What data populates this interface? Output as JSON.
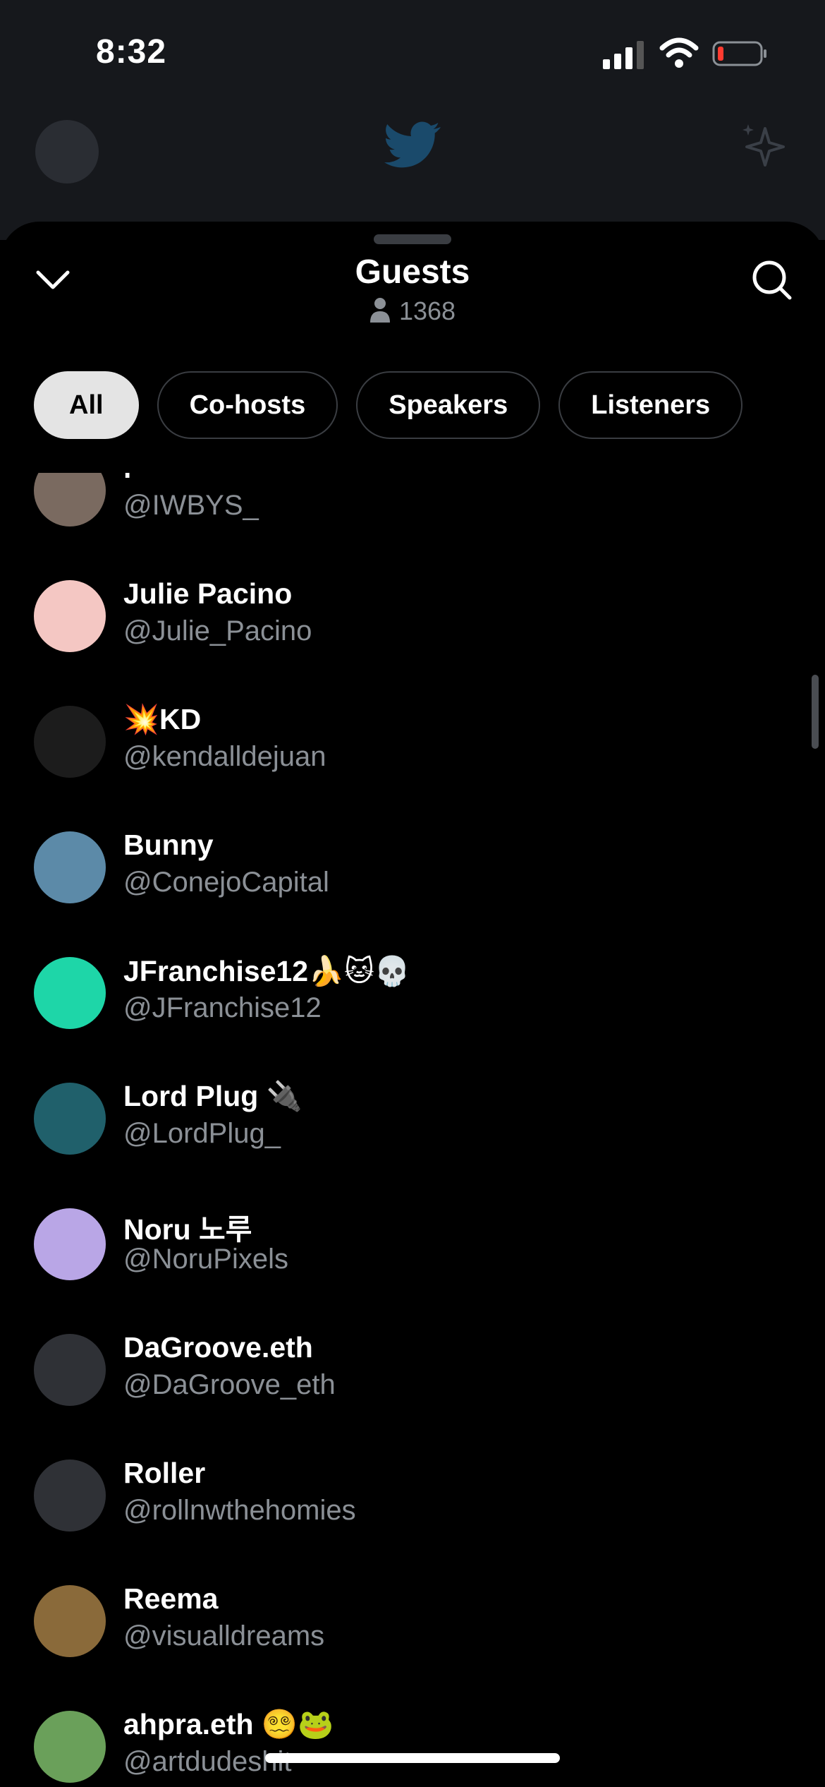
{
  "status": {
    "time": "8:32"
  },
  "sheet": {
    "title": "Guests",
    "count": "1368",
    "filters": [
      "All",
      "Co-hosts",
      "Speakers",
      "Listeners"
    ]
  },
  "guests": [
    {
      "name": "r",
      "handle": "@IWBYS_",
      "avatar_color": "#7a6a60"
    },
    {
      "name": "Julie Pacino",
      "handle": "@Julie_Pacino",
      "avatar_color": "#f4c7c3"
    },
    {
      "name": "💥KD",
      "handle": "@kendalldejuan",
      "avatar_color": "#1c1c1c"
    },
    {
      "name": "Bunny",
      "handle": "@ConejoCapital",
      "avatar_color": "#5c8aa8"
    },
    {
      "name": "JFranchise12🍌🐱💀",
      "handle": "@JFranchise12",
      "avatar_color": "#1ed6a8"
    },
    {
      "name": "Lord Plug 🔌",
      "handle": "@LordPlug_",
      "avatar_color": "#20606b"
    },
    {
      "name": "Noru 노루",
      "handle": "@NoruPixels",
      "avatar_color": "#b9a6e6"
    },
    {
      "name": "DaGroove.eth",
      "handle": "@DaGroove_eth",
      "avatar_color": "#2f3136"
    },
    {
      "name": "Roller",
      "handle": "@rollnwthehomies",
      "avatar_color": "#2f3136"
    },
    {
      "name": "Reema",
      "handle": "@visualldreams",
      "avatar_color": "#8a6a3a"
    },
    {
      "name": "ahpra.eth 😵‍💫🐸",
      "handle": "@artdudeshit",
      "avatar_color": "#6aa05a"
    }
  ],
  "colors": {
    "accent": "#1d9bf0",
    "battery_low": "#ff3b30"
  }
}
